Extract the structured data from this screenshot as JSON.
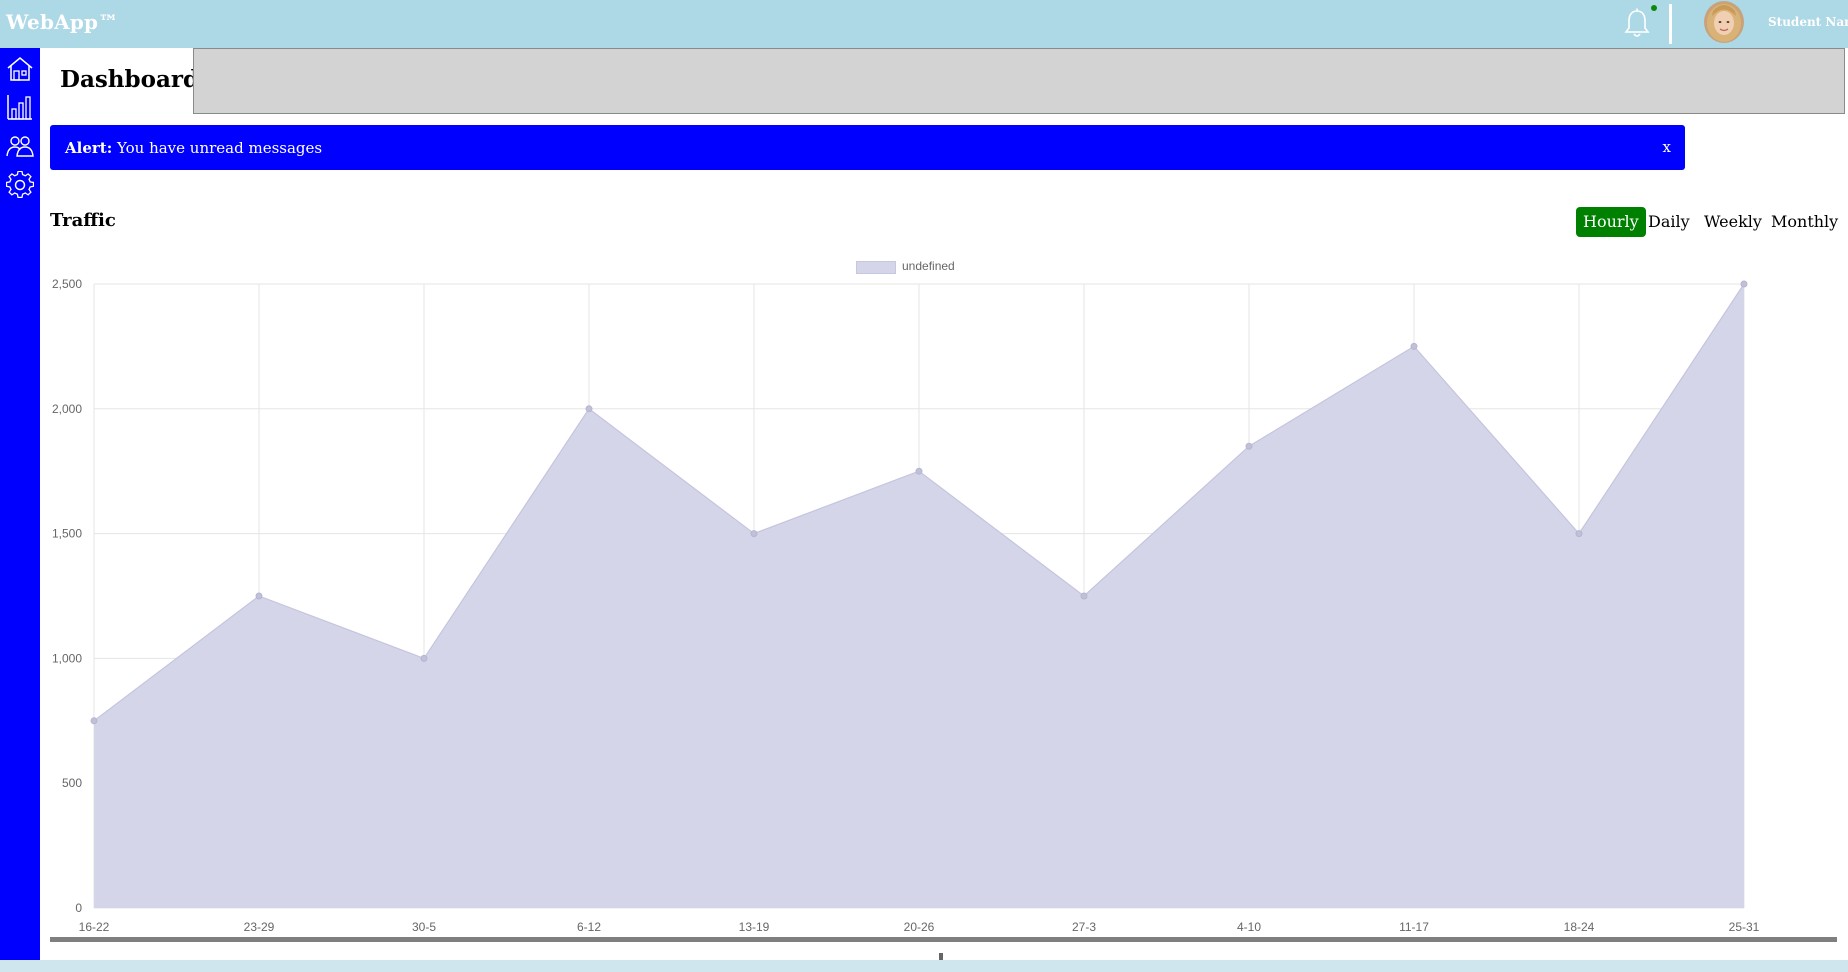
{
  "app": {
    "brand": "WebApp™",
    "user_name": "Student Name"
  },
  "colors": {
    "topbar": "#add8e6",
    "sidebar": "#0000ff",
    "alert": "#0000ff",
    "active_tab": "#008000",
    "area_fill": "#d5d5ea"
  },
  "sidebar": {
    "items": [
      {
        "icon": "home-icon"
      },
      {
        "icon": "bar-chart-icon"
      },
      {
        "icon": "users-icon"
      },
      {
        "icon": "gear-icon"
      }
    ]
  },
  "header": {
    "title": "Dashboard"
  },
  "alert": {
    "label": "Alert:",
    "message": " You have unread messages",
    "close": "x"
  },
  "traffic": {
    "title": "Traffic",
    "tabs": [
      "Hourly",
      "Daily",
      "Weekly",
      "Monthly"
    ],
    "active_tab": "Hourly"
  },
  "chart_data": {
    "type": "area",
    "legend": [
      "undefined"
    ],
    "categories": [
      "16-22",
      "23-29",
      "30-5",
      "6-12",
      "13-19",
      "20-26",
      "27-3",
      "4-10",
      "11-17",
      "18-24",
      "25-31"
    ],
    "series": [
      {
        "name": "undefined",
        "values": [
          750,
          1250,
          1000,
          2000,
          1500,
          1750,
          1250,
          1850,
          2250,
          1500,
          2500
        ]
      }
    ],
    "ylim": [
      0,
      2500
    ],
    "yticks": [
      0,
      500,
      1000,
      1500,
      2000,
      2500
    ],
    "ytick_labels": [
      "0",
      "500",
      "1,000",
      "1,500",
      "2,000",
      "2,500"
    ],
    "grid": true,
    "legend_position": "top-center"
  }
}
